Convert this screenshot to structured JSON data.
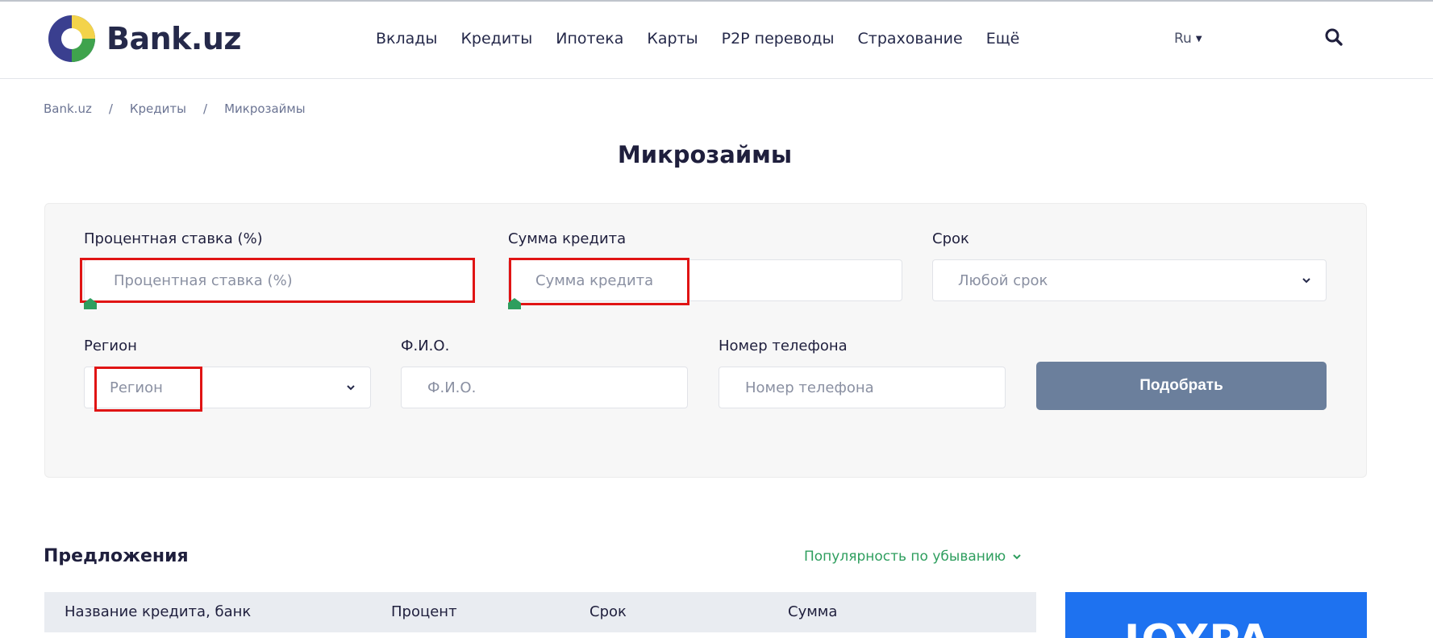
{
  "header": {
    "logo_text": "Bank.uz",
    "nav": [
      "Вклады",
      "Кредиты",
      "Ипотека",
      "Карты",
      "P2P переводы",
      "Страхование",
      "Ещё"
    ],
    "language": "Ru"
  },
  "breadcrumb": [
    "Bank.uz",
    "Кредиты",
    "Микрозаймы"
  ],
  "breadcrumb_separator": "/",
  "page_title": "Микрозаймы",
  "filters": {
    "rate": {
      "label": "Процентная ставка (%)",
      "placeholder": "Процентная ставка (%)"
    },
    "amount": {
      "label": "Сумма кредита",
      "placeholder": "Сумма кредита"
    },
    "term": {
      "label": "Срок",
      "selected": "Любой срок"
    },
    "region": {
      "label": "Регион",
      "selected": "Регион"
    },
    "fio": {
      "label": "Ф.И.О.",
      "placeholder": "Ф.И.О."
    },
    "phone": {
      "label": "Номер телефона",
      "placeholder": "Номер телефона"
    },
    "submit_label": "Подобрать"
  },
  "offers": {
    "title": "Предложения",
    "sort_label": "Популярность по убыванию",
    "columns": [
      "Название кредита, банк",
      "Процент",
      "Срок",
      "Сумма"
    ]
  },
  "ad": {
    "text": "JOYPA"
  },
  "colors": {
    "brand_dark": "#25294a",
    "accent_green": "#2e9e5e",
    "button": "#6b7f9c",
    "highlight_red": "#e01414",
    "ad_blue": "#1e72f0"
  }
}
